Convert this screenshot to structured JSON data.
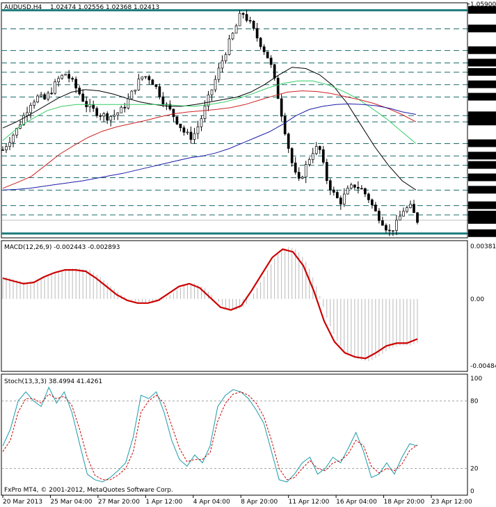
{
  "chart_data": [
    {
      "type": "candlestick",
      "header": {
        "symbol": "AUDUSD,H4",
        "values": [
          "1.02474",
          "1.02556",
          "1.02368",
          "1.02413"
        ]
      },
      "ylim": [
        1.0213,
        1.0592
      ],
      "price_scale_labels": [
        "1.05900",
        "1.05800",
        "1.05500",
        "1.05150",
        "1.04950",
        "1.04800",
        "1.04600",
        "1.04400",
        "1.04100",
        "1.04000",
        "1.03650",
        "1.03450",
        "1.03300",
        "1.03100",
        "1.02900",
        "1.02650",
        "1.02500",
        "1.02413",
        "1.02200"
      ],
      "levels": [
        1.058,
        1.055,
        1.0515,
        1.0495,
        1.048,
        1.046,
        1.044,
        1.041,
        1.04,
        1.0365,
        1.0345,
        1.033,
        1.031,
        1.029,
        1.0265,
        1.025,
        1.022
      ],
      "highlight_levels": [
        1.058,
        1.022
      ],
      "current_price": 1.02413,
      "x_labels": [
        "20 Mar 2013",
        "25 Mar 04:00",
        "27 Mar 20:00",
        "1 Apr 12:00",
        "4 Apr 04:00",
        "8 Apr 20:00",
        "11 Apr 12:00",
        "16 Apr 04:00",
        "18 Apr 20:00",
        "23 Apr 12:00"
      ],
      "close_path": [
        1.0355,
        1.0372,
        1.0388,
        1.041,
        1.0432,
        1.044,
        1.0436,
        1.0452,
        1.047,
        1.0478,
        1.0462,
        1.0444,
        1.0425,
        1.0418,
        1.0412,
        1.0408,
        1.0412,
        1.042,
        1.0438,
        1.046,
        1.0475,
        1.047,
        1.0452,
        1.043,
        1.0415,
        1.0398,
        1.038,
        1.0375,
        1.0398,
        1.043,
        1.046,
        1.0492,
        1.0522,
        1.0548,
        1.0578,
        1.0562,
        1.054,
        1.052,
        1.0498,
        1.045,
        1.0395,
        1.034,
        1.03,
        1.0325,
        1.0352,
        1.036,
        1.031,
        1.0285,
        1.027,
        1.0288,
        1.0298,
        1.0292,
        1.0278,
        1.0255,
        1.024,
        1.0222,
        1.0235,
        1.0258,
        1.0262,
        1.0241
      ],
      "series": [
        {
          "name": "",
          "color": "#000000",
          "values": [
            1.039,
            1.04,
            1.0412,
            1.0425,
            1.0438,
            1.0448,
            1.0452,
            1.045,
            1.0445,
            1.0438,
            1.0432,
            1.0428,
            1.0425,
            1.0425,
            1.0428,
            1.0432,
            1.0436,
            1.044,
            1.0448,
            1.046,
            1.0475,
            1.0488,
            1.0486,
            1.0476,
            1.0458,
            1.043,
            1.0395,
            1.036,
            1.033,
            1.0305,
            1.029
          ]
        },
        {
          "name": "",
          "color": "#33cc66",
          "values": [
            1.037,
            1.039,
            1.0405,
            1.0418,
            1.0425,
            1.0428,
            1.0428,
            1.0428,
            1.0428,
            1.0428,
            1.0428,
            1.0428,
            1.0426,
            1.0425,
            1.0428,
            1.0432,
            1.0438,
            1.0446,
            1.0455,
            1.0462,
            1.0466,
            1.0466,
            1.046,
            1.045,
            1.0438,
            1.0422,
            1.0405,
            1.0385,
            1.0365
          ]
        },
        {
          "name": "",
          "color": "#cc2222",
          "values": [
            1.0293,
            1.0302,
            1.0312,
            1.033,
            1.0348,
            1.0362,
            1.0375,
            1.0385,
            1.0392,
            1.0397,
            1.0402,
            1.0408,
            1.0413,
            1.0416,
            1.0418,
            1.042,
            1.0423,
            1.0428,
            1.0435,
            1.0442,
            1.0448,
            1.045,
            1.0449,
            1.0446,
            1.0441,
            1.0436,
            1.043,
            1.0422,
            1.0412,
            1.04
          ]
        },
        {
          "name": "",
          "color": "#1a1aa8",
          "values": [
            1.029,
            1.0291,
            1.0293,
            1.0296,
            1.0299,
            1.0302,
            1.0305,
            1.0309,
            1.0313,
            1.0317,
            1.0322,
            1.0327,
            1.0332,
            1.0337,
            1.0342,
            1.0345,
            1.035,
            1.0357,
            1.0366,
            1.0375,
            1.0384,
            1.0396,
            1.041,
            1.042,
            1.0425,
            1.0428,
            1.0429,
            1.0428,
            1.0426,
            1.0422,
            1.0416,
            1.0412
          ]
        }
      ]
    },
    {
      "type": "line",
      "title": "MACD(12,26,9) -0.002443 -0.002893",
      "ylim": [
        -0.00484,
        0.003814
      ],
      "y_labels": [
        "0.003814",
        "0.00",
        "-0.00484"
      ],
      "series": [
        {
          "name": "",
          "color": "#cc0000",
          "values": [
            0.0015,
            0.0013,
            0.0011,
            0.0012,
            0.0016,
            0.0019,
            0.0021,
            0.0021,
            0.002,
            0.0015,
            0.0009,
            0.0003,
            -0.0001,
            -0.0003,
            -0.0003,
            -0.0001,
            0.0004,
            0.0009,
            0.0011,
            0.0008,
            0.0001,
            -0.0006,
            -0.0008,
            -0.0005,
            0.0006,
            0.0018,
            0.003,
            0.0036,
            0.0034,
            0.0024,
            0.0006,
            -0.0016,
            -0.0031,
            -0.0039,
            -0.0042,
            -0.0043,
            -0.0039,
            -0.0034,
            -0.0032,
            -0.0032,
            -0.0029
          ]
        }
      ]
    },
    {
      "type": "line",
      "title": "Stoch(13,3,3) 38.4994 41.4261",
      "ylim": [
        0,
        100
      ],
      "y_labels": [
        "100",
        "80",
        "20",
        "0"
      ],
      "series": [
        {
          "name": "",
          "color": "#1a9aa8",
          "values": [
            40,
            55,
            80,
            88,
            80,
            75,
            92,
            78,
            88,
            70,
            42,
            15,
            10,
            8,
            12,
            18,
            25,
            48,
            85,
            82,
            88,
            70,
            45,
            28,
            22,
            32,
            25,
            40,
            75,
            85,
            90,
            88,
            82,
            72,
            60,
            35,
            10,
            8,
            15,
            25,
            30,
            15,
            20,
            30,
            25,
            38,
            52,
            35,
            12,
            15,
            25,
            15,
            30,
            42,
            40
          ]
        },
        {
          "name": "",
          "color": "#cc0000",
          "values": [
            35,
            45,
            70,
            82,
            82,
            78,
            86,
            82,
            84,
            76,
            55,
            30,
            14,
            10,
            10,
            14,
            20,
            35,
            70,
            80,
            85,
            78,
            58,
            38,
            26,
            28,
            28,
            34,
            62,
            78,
            86,
            88,
            85,
            78,
            66,
            45,
            20,
            10,
            12,
            20,
            27,
            20,
            18,
            25,
            27,
            33,
            45,
            40,
            22,
            16,
            20,
            18,
            24,
            36,
            41
          ]
        }
      ]
    }
  ],
  "footer": "FxPro MT4, © 2001-2012, MetaQuotes Software Corp."
}
